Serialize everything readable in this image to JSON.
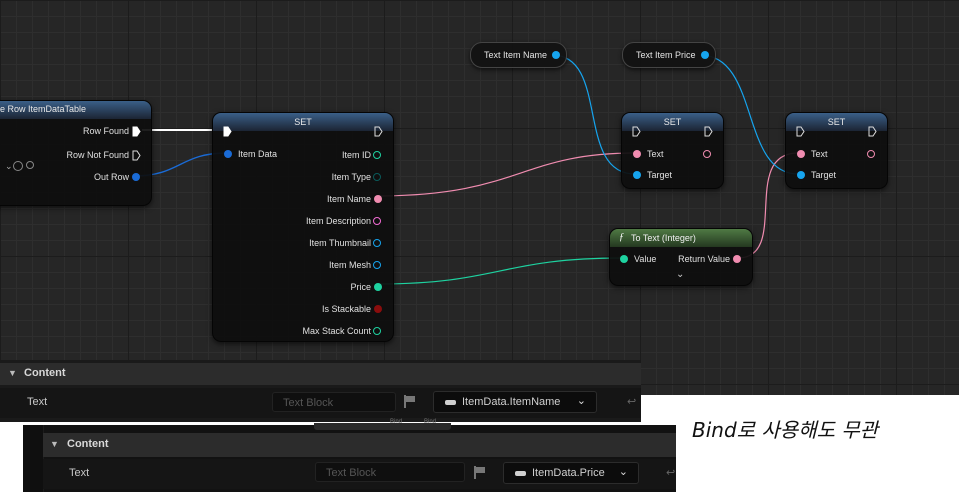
{
  "graph": {
    "get_row_node": {
      "title": "e Row ItemDataTable",
      "pins": {
        "row_found": "Row Found",
        "row_not_found": "Row Not Found",
        "out_row": "Out Row"
      }
    },
    "set_struct_node": {
      "title": "SET",
      "input_pin": "Item Data",
      "outputs": [
        "Item ID",
        "Item Type",
        "Item Name",
        "Item Description",
        "Item Thumbnail",
        "Item Mesh",
        "Price",
        "Is Stackable",
        "Max Stack Count"
      ]
    },
    "var_name": {
      "label": "Text Item Name"
    },
    "var_price": {
      "label": "Text Item Price"
    },
    "set_text_node_1": {
      "title": "SET",
      "pins": {
        "text": "Text",
        "target": "Target"
      }
    },
    "set_text_node_2": {
      "title": "SET",
      "pins": {
        "text": "Text",
        "target": "Target"
      }
    },
    "to_text_node": {
      "title": "To Text (Integer)",
      "function_icon": "function-icon",
      "pins": {
        "value": "Value",
        "return": "Return Value"
      }
    }
  },
  "panel1": {
    "category": "Content",
    "row_label": "Text",
    "textblock_placeholder": "Text Block",
    "binding": "ItemData.ItemName"
  },
  "panel2": {
    "category": "Content",
    "row_label": "Text",
    "textblock_placeholder": "Text Block",
    "binding": "ItemData.Price",
    "tabs_partial": [
      "Bind",
      "Bind"
    ]
  },
  "annotation": "Bind로 사용해도 무관",
  "colors": {
    "exec": "#ffffff",
    "struct_blue": "#1a6bd6",
    "object_blue": "#16a4ee",
    "text_pink": "#f08cb0",
    "int_green": "#1ed2a0",
    "bool_red": "#8a0d0d",
    "name_purple": "#c99bdb",
    "string_pink": "#f26bd4"
  }
}
